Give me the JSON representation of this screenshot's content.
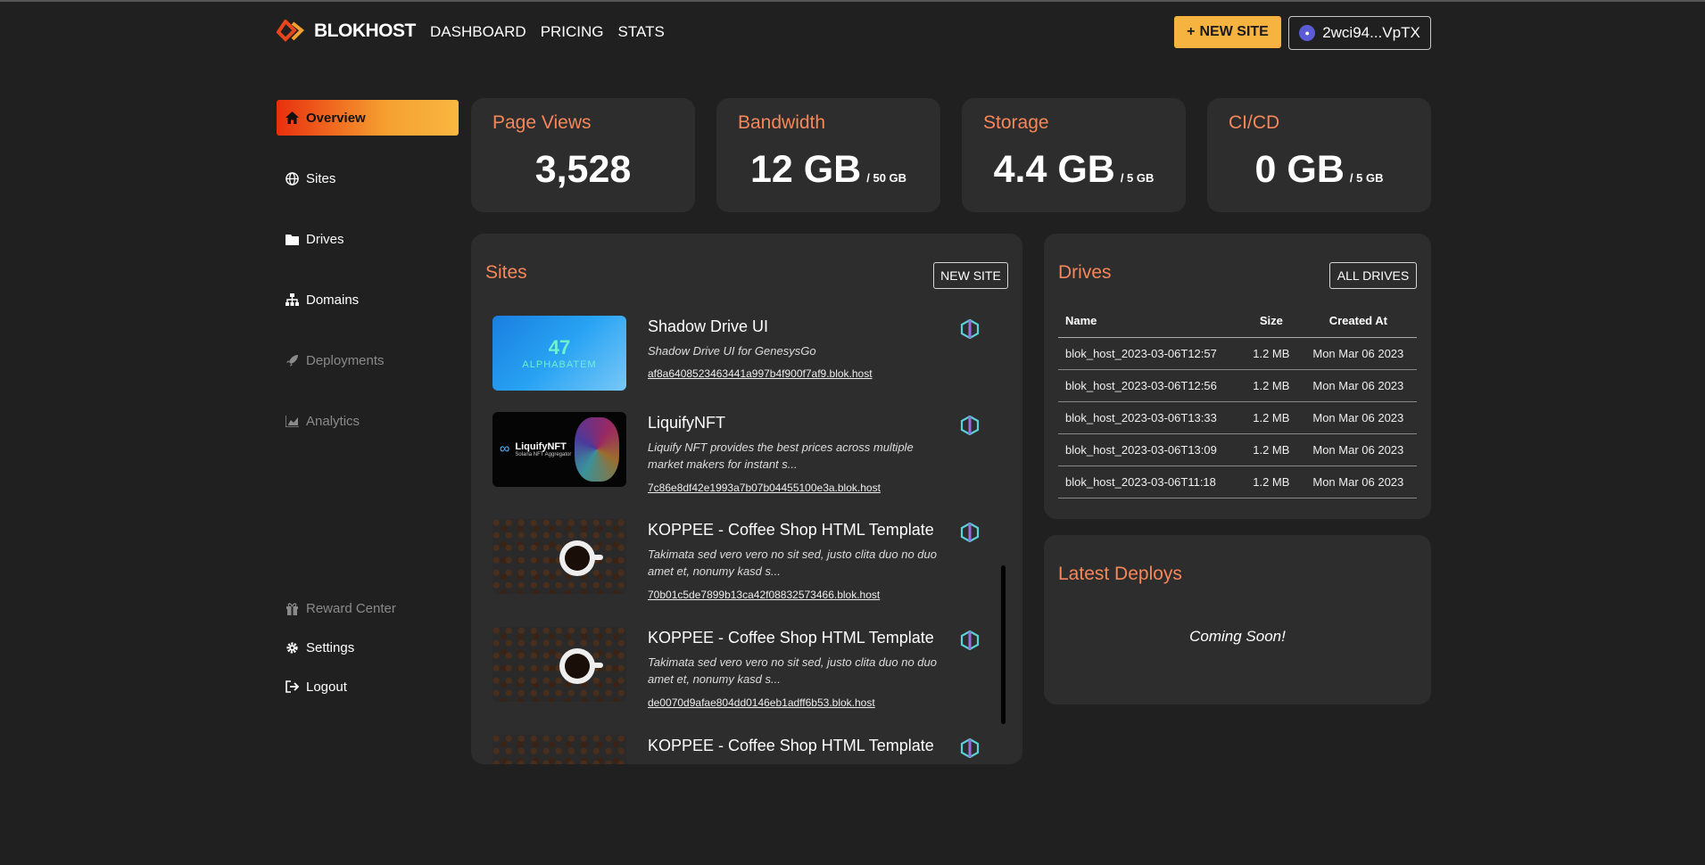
{
  "brand": {
    "name": "BLOKHOST"
  },
  "nav": {
    "dashboard": "DASHBOARD",
    "pricing": "PRICING",
    "stats": "STATS"
  },
  "header": {
    "new_site": "NEW SITE",
    "wallet": "2wci94...VpTX"
  },
  "sidebar": {
    "items": [
      {
        "label": "Overview"
      },
      {
        "label": "Sites"
      },
      {
        "label": "Drives"
      },
      {
        "label": "Domains"
      },
      {
        "label": "Deployments"
      },
      {
        "label": "Analytics"
      }
    ],
    "bottom": [
      {
        "label": "Reward Center"
      },
      {
        "label": "Settings"
      },
      {
        "label": "Logout"
      }
    ]
  },
  "stats": [
    {
      "title": "Page Views",
      "value": "3,528",
      "unit": ""
    },
    {
      "title": "Bandwidth",
      "value": "12 GB",
      "unit": "/ 50 GB"
    },
    {
      "title": "Storage",
      "value": "4.4 GB",
      "unit": "/ 5 GB"
    },
    {
      "title": "CI/CD",
      "value": "0 GB",
      "unit": "/ 5 GB"
    }
  ],
  "sites": {
    "title": "Sites",
    "button": "NEW SITE",
    "items": [
      {
        "name": "Shadow Drive UI",
        "desc": "Shadow Drive UI for GenesysGo",
        "url": "af8a6408523463441a997b4f900f7af9.blok.host",
        "thumb_text": "ALPHABATEM"
      },
      {
        "name": "LiquifyNFT",
        "desc": "Liquify NFT provides the best prices across multiple market makers for instant s...",
        "url": "7c86e8df42e1993a7b07b04455100e3a.blok.host",
        "thumb_text": "LiquifyNFT",
        "thumb_sub": "Solana NFT Aggregator"
      },
      {
        "name": "KOPPEE - Coffee Shop HTML Template",
        "desc": "Takimata sed vero vero no sit sed, justo clita duo no duo amet et, nonumy kasd s...",
        "url": "70b01c5de7899b13ca42f08832573466.blok.host"
      },
      {
        "name": "KOPPEE - Coffee Shop HTML Template",
        "desc": "Takimata sed vero vero no sit sed, justo clita duo no duo amet et, nonumy kasd s...",
        "url": "de0070d9afae804dd0146eb1adff6b53.blok.host"
      },
      {
        "name": "KOPPEE - Coffee Shop HTML Template",
        "desc": "",
        "url": ""
      }
    ]
  },
  "drives": {
    "title": "Drives",
    "button": "ALL DRIVES",
    "columns": [
      "Name",
      "Size",
      "Created At"
    ],
    "rows": [
      [
        "blok_host_2023-03-06T12:57",
        "1.2 MB",
        "Mon Mar 06 2023"
      ],
      [
        "blok_host_2023-03-06T12:56",
        "1.2 MB",
        "Mon Mar 06 2023"
      ],
      [
        "blok_host_2023-03-06T13:33",
        "1.2 MB",
        "Mon Mar 06 2023"
      ],
      [
        "blok_host_2023-03-06T13:09",
        "1.2 MB",
        "Mon Mar 06 2023"
      ],
      [
        "blok_host_2023-03-06T11:18",
        "1.2 MB",
        "Mon Mar 06 2023"
      ]
    ]
  },
  "deploys": {
    "title": "Latest Deploys",
    "message": "Coming Soon!"
  },
  "colors": {
    "accent": "#f6b33f",
    "title": "#f5875a",
    "panel": "#2d2d2d",
    "bg": "#202020"
  }
}
